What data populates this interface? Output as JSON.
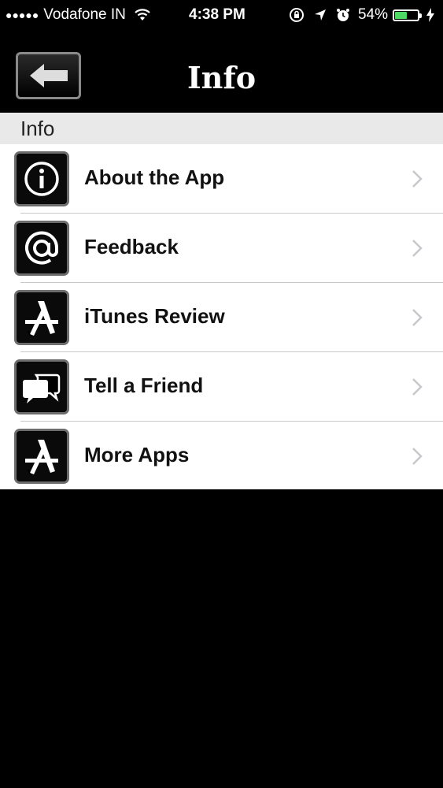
{
  "status_bar": {
    "carrier": "Vodafone IN",
    "time": "4:38 PM",
    "battery_percent": "54%",
    "battery_level": 0.54
  },
  "nav": {
    "title": "Info"
  },
  "section": {
    "header": "Info"
  },
  "rows": [
    {
      "label": "About the App",
      "icon": "info-icon"
    },
    {
      "label": "Feedback",
      "icon": "at-sign-icon"
    },
    {
      "label": "iTunes Review",
      "icon": "app-store-icon"
    },
    {
      "label": "Tell a Friend",
      "icon": "chat-bubbles-icon"
    },
    {
      "label": "More Apps",
      "icon": "app-store-icon"
    }
  ]
}
